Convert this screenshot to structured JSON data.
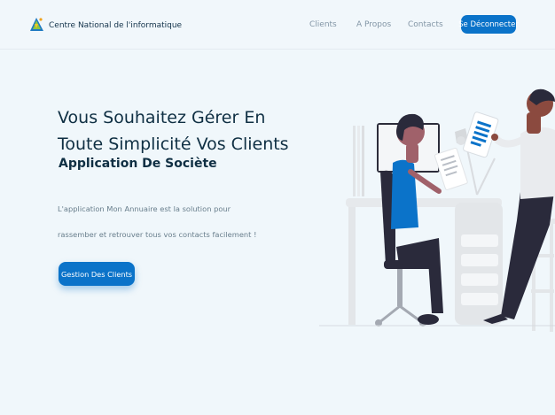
{
  "header": {
    "brand": "Centre National de l'informatique",
    "nav": [
      "Clients",
      "A Propos",
      "Contacts"
    ],
    "logout": "Se Déconnecter"
  },
  "hero": {
    "title_line1": "Vous Souhaitez Gérer En",
    "title_line2": "Toute Simplicité Vos Clients",
    "subtitle": "Application De Sociète",
    "description": "L'application Mon Annuaire est la solution pour rassember et retrouver tous vos contacts facilement !",
    "cta": "Gestion Des Clients"
  },
  "colors": {
    "accent": "#0b73c9",
    "background": "#f0f7fb",
    "heading": "#0f2f43",
    "muted": "#687e8c"
  }
}
